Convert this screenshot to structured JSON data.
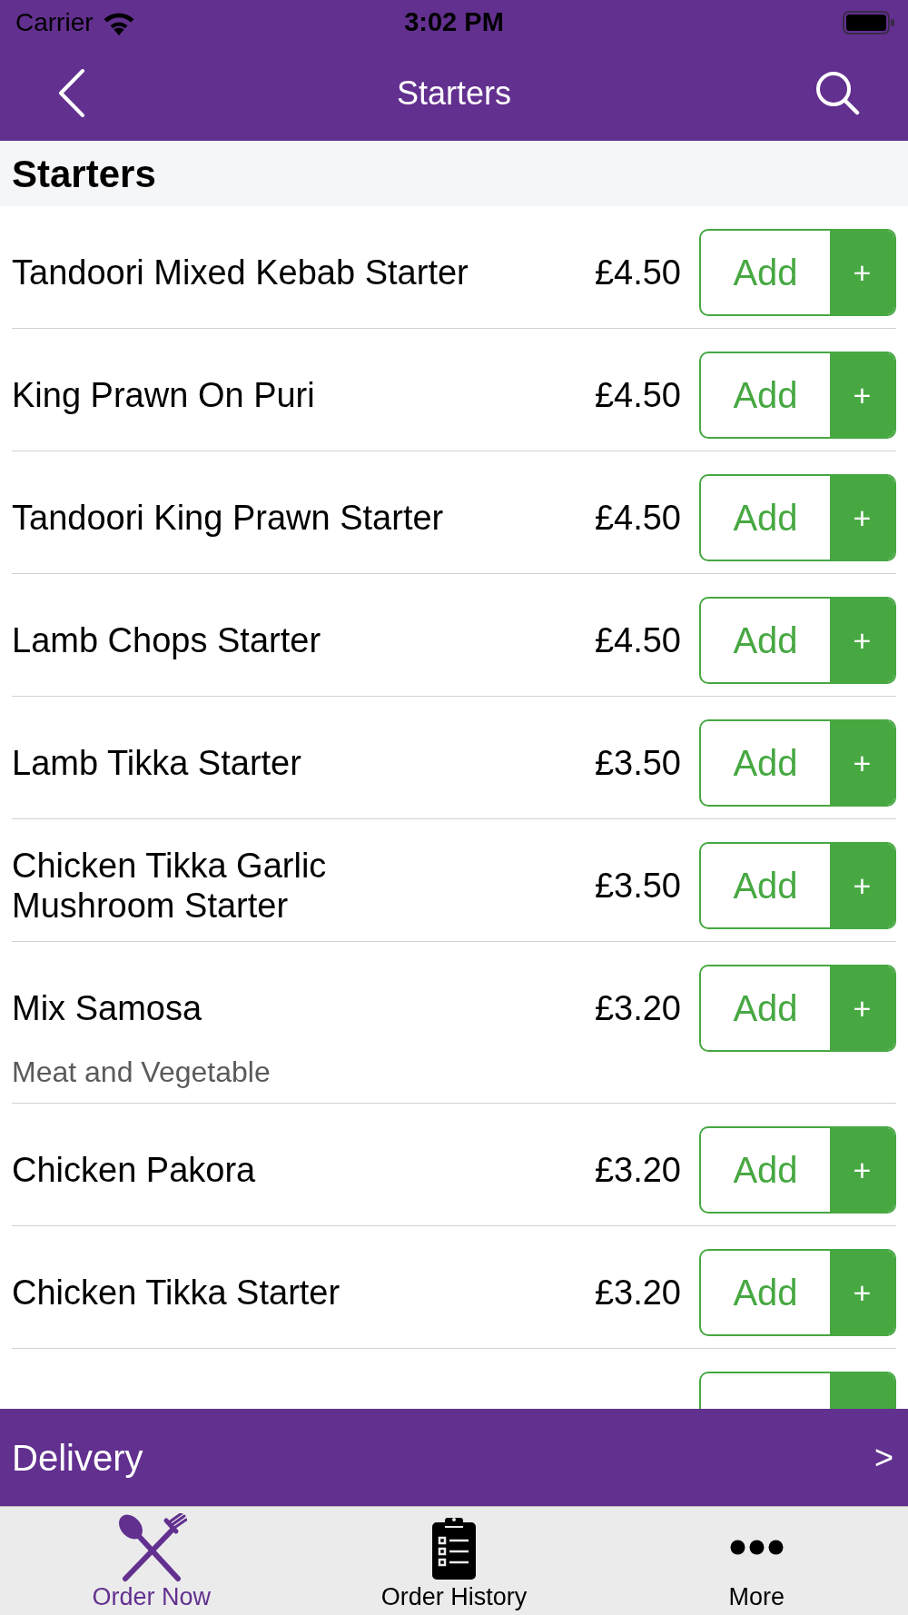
{
  "status_bar": {
    "carrier": "Carrier",
    "time": "3:02 PM"
  },
  "nav_bar": {
    "title": "Starters"
  },
  "section": {
    "title": "Starters"
  },
  "items": [
    {
      "name": "Tandoori Mixed Kebab Starter",
      "price": "£4.50",
      "add_label": "Add",
      "plus_label": "+"
    },
    {
      "name": "King Prawn On Puri",
      "price": "£4.50",
      "add_label": "Add",
      "plus_label": "+"
    },
    {
      "name": "Tandoori King Prawn Starter",
      "price": "£4.50",
      "add_label": "Add",
      "plus_label": "+"
    },
    {
      "name": "Lamb Chops Starter",
      "price": "£4.50",
      "add_label": "Add",
      "plus_label": "+"
    },
    {
      "name": "Lamb Tikka Starter",
      "price": "£3.50",
      "add_label": "Add",
      "plus_label": "+"
    },
    {
      "name": "Chicken Tikka Garlic Mushroom Starter",
      "price": "£3.50",
      "add_label": "Add",
      "plus_label": "+"
    },
    {
      "name": "Mix Samosa",
      "description": "Meat and Vegetable",
      "price": "£3.20",
      "add_label": "Add",
      "plus_label": "+"
    },
    {
      "name": "Chicken Pakora",
      "price": "£3.20",
      "add_label": "Add",
      "plus_label": "+"
    },
    {
      "name": "Chicken Tikka Starter",
      "price": "£3.20",
      "add_label": "Add",
      "plus_label": "+"
    }
  ],
  "delivery_bar": {
    "label": "Delivery",
    "arrow": ">"
  },
  "tab_bar": [
    {
      "label": "Order Now",
      "selected": true
    },
    {
      "label": "Order History",
      "selected": false
    },
    {
      "label": "More",
      "selected": false
    }
  ]
}
